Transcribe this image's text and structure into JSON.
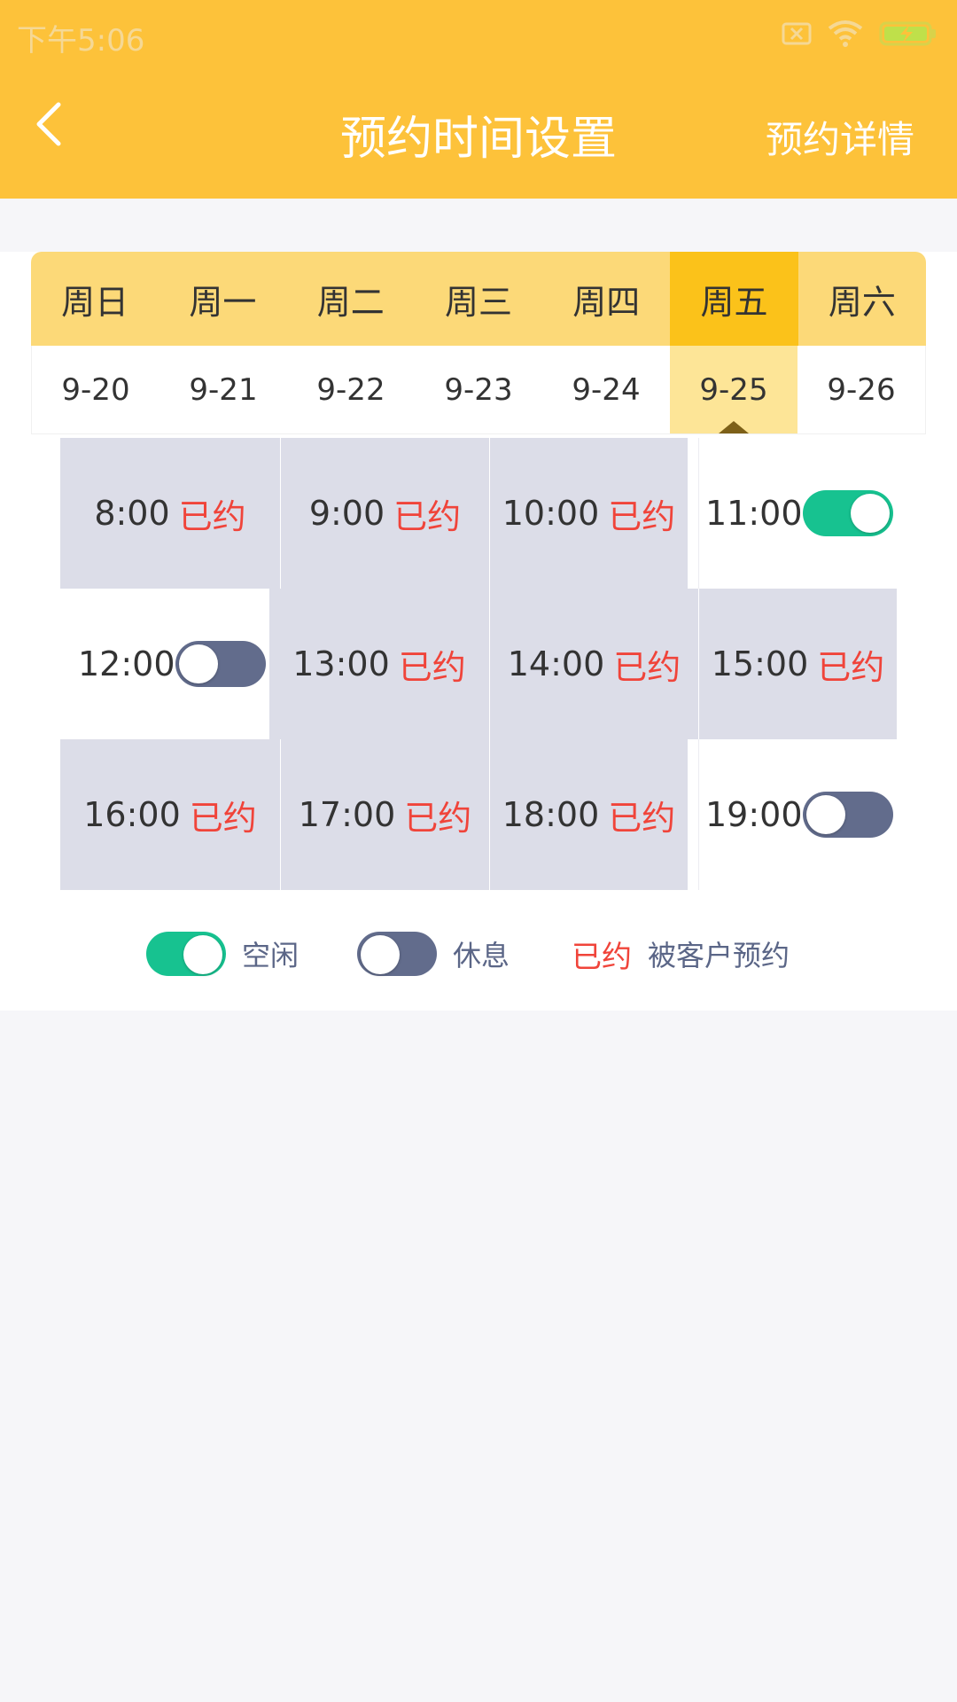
{
  "status_bar": {
    "time": "下午5:06"
  },
  "header": {
    "title": "预约时间设置",
    "detail_link": "预约详情"
  },
  "week": {
    "days": [
      {
        "label": "周日",
        "date": "9-20"
      },
      {
        "label": "周一",
        "date": "9-21"
      },
      {
        "label": "周二",
        "date": "9-22"
      },
      {
        "label": "周三",
        "date": "9-23"
      },
      {
        "label": "周四",
        "date": "9-24"
      },
      {
        "label": "周五",
        "date": "9-25"
      },
      {
        "label": "周六",
        "date": "9-26"
      }
    ],
    "selected_index": 5
  },
  "slots": [
    {
      "time": "8:00",
      "tag": "已约"
    },
    {
      "time": "9:00",
      "tag": "已约"
    },
    {
      "time": "10:00",
      "tag": "已约"
    },
    {
      "time": "11:00",
      "toggle": "on"
    },
    {
      "time": "12:00",
      "toggle": "off"
    },
    {
      "time": "13:00",
      "tag": "已约"
    },
    {
      "time": "14:00",
      "tag": "已约"
    },
    {
      "time": "15:00",
      "tag": "已约"
    },
    {
      "time": "16:00",
      "tag": "已约"
    },
    {
      "time": "17:00",
      "tag": "已约"
    },
    {
      "time": "18:00",
      "tag": "已约"
    },
    {
      "time": "19:00",
      "toggle": "off"
    }
  ],
  "legend": {
    "free": "空闲",
    "rest": "休息",
    "booked": "已约",
    "booked_desc": "被客户预约"
  },
  "colors": {
    "brand": "#fdc23a",
    "day_active": "#fbc21a",
    "booked_bg": "#dcdde8",
    "booked_text": "#f0443a",
    "toggle_on": "#17c290",
    "toggle_off": "#626c8c"
  }
}
